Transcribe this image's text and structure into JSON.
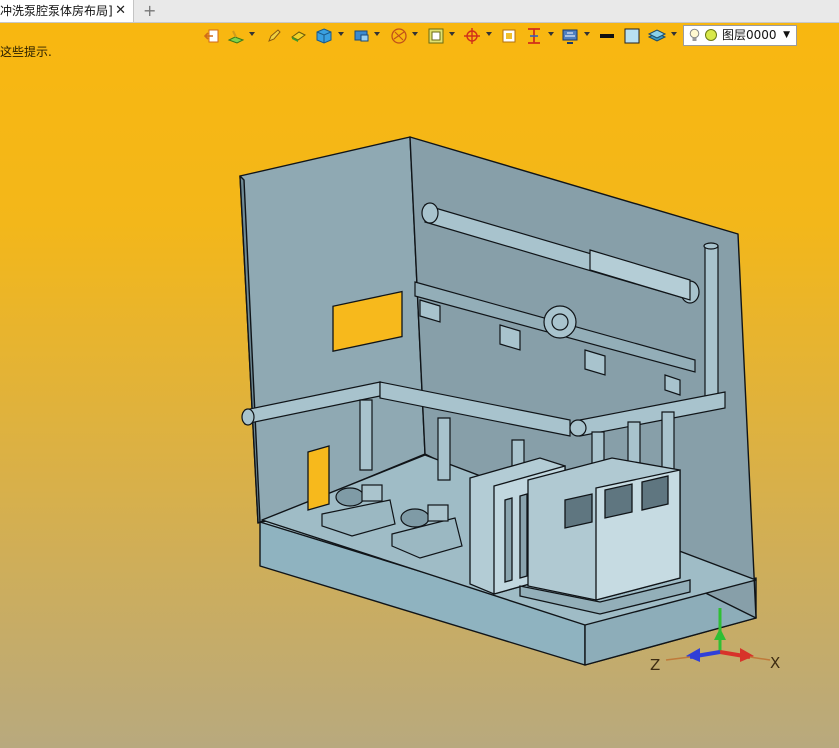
{
  "tab": {
    "title": "冲洗泵腔泵体房布局]",
    "close_glyph": "✕",
    "add_glyph": "+"
  },
  "hint": "这些提示.",
  "toolbar": {
    "tools": [
      {
        "name": "exit-sketch-icon"
      },
      {
        "name": "sketch-plane-icon"
      },
      {
        "name": "pencil-icon"
      },
      {
        "name": "eraser-icon"
      },
      {
        "name": "solid-cube-icon"
      },
      {
        "name": "render-mode-icon"
      },
      {
        "name": "snap-filter-icon"
      },
      {
        "name": "view-orient-icon"
      },
      {
        "name": "origin-target-icon"
      },
      {
        "name": "fit-view-icon"
      },
      {
        "name": "section-view-icon"
      },
      {
        "name": "display-settings-icon"
      },
      {
        "name": "line-color-icon"
      },
      {
        "name": "face-color-icon"
      },
      {
        "name": "layers-icon"
      }
    ]
  },
  "layer": {
    "label": "图层0000",
    "dropdown_glyph": "▼"
  },
  "axes": {
    "x": "X",
    "z": "Z"
  },
  "colors": {
    "background_top": "#f9b70f",
    "background_bottom": "#b8a97e",
    "model_fill": "#8ea7b2",
    "axis_x": "#d8322a",
    "axis_y": "#2fbf34",
    "axis_z": "#2f3fd8"
  }
}
